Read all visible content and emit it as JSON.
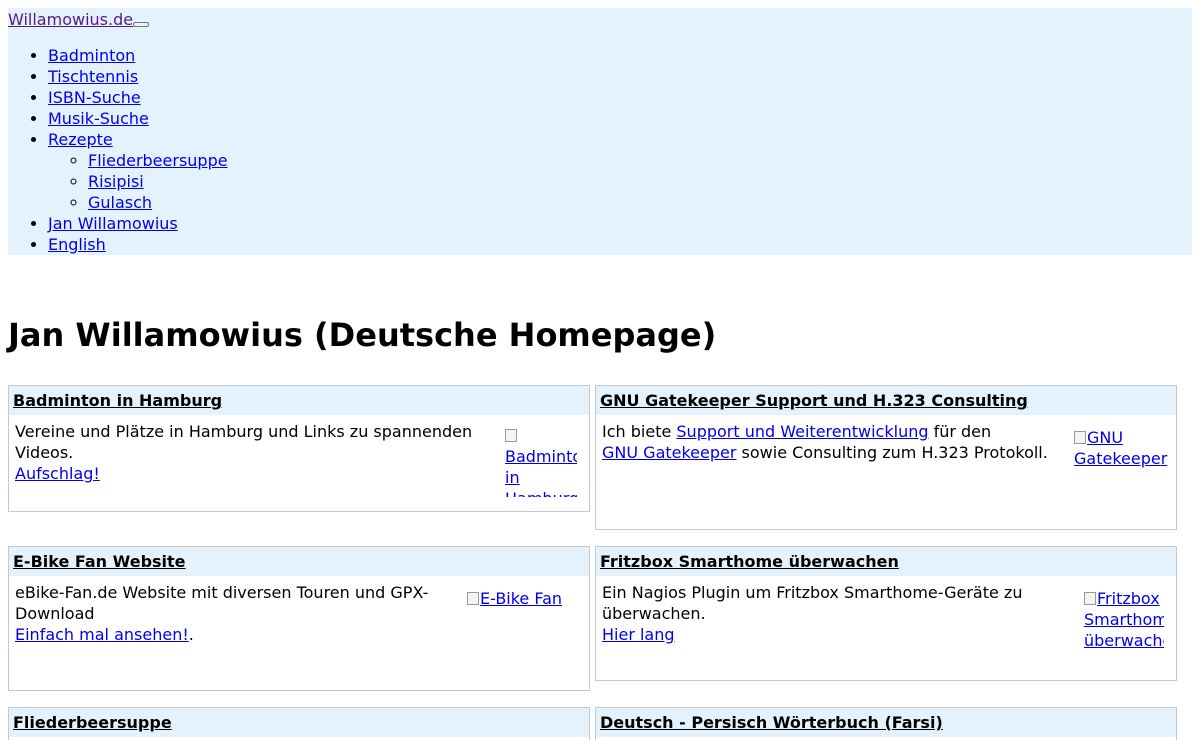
{
  "navbar": {
    "brand": "Willamowius.de",
    "items": [
      {
        "label": "Badminton"
      },
      {
        "label": "Tischtennis"
      },
      {
        "label": "ISBN-Suche"
      },
      {
        "label": "Musik-Suche"
      },
      {
        "label": "Rezepte",
        "children": [
          {
            "label": "Fliederbeersuppe"
          },
          {
            "label": "Risipisi"
          },
          {
            "label": "Gulasch"
          }
        ]
      },
      {
        "label": "Jan Willamowius"
      },
      {
        "label": "English"
      }
    ]
  },
  "page_title": "Jan Willamowius (Deutsche Homepage)",
  "cards": [
    {
      "title": "Badminton in Hamburg",
      "text": "Vereine und Plätze in Hamburg und Links zu spannenden Videos.",
      "link": "Aufschlag!",
      "after": "",
      "img_alt": "Badminton in Hamburg"
    },
    {
      "title": "GNU Gatekeeper Support und H.323 Consulting",
      "pre": "Ich biete ",
      "link1": "Support und Weiterentwicklung",
      "mid": " für den ",
      "link2": "GNU Gatekeeper",
      "post": " sowie Consulting zum H.323 Protokoll.",
      "img_alt": "GNU Gatekeeper"
    },
    {
      "title": "E-Bike Fan Website",
      "text": "eBike-Fan.de Website mit diversen Touren und GPX-Download",
      "link": "Einfach mal ansehen!",
      "after": ".",
      "img_alt": "E-Bike Fan"
    },
    {
      "title": "Fritzbox Smarthome überwachen",
      "text": "Ein Nagios Plugin um Fritzbox Smarthome-Geräte zu überwachen.",
      "link": "Hier lang",
      "after": "",
      "img_alt": "Fritzbox Smarthome überwachen"
    },
    {
      "title": "Fliederbeersuppe"
    },
    {
      "title": "Deutsch - Persisch Wörterbuch (Farsi)"
    }
  ]
}
